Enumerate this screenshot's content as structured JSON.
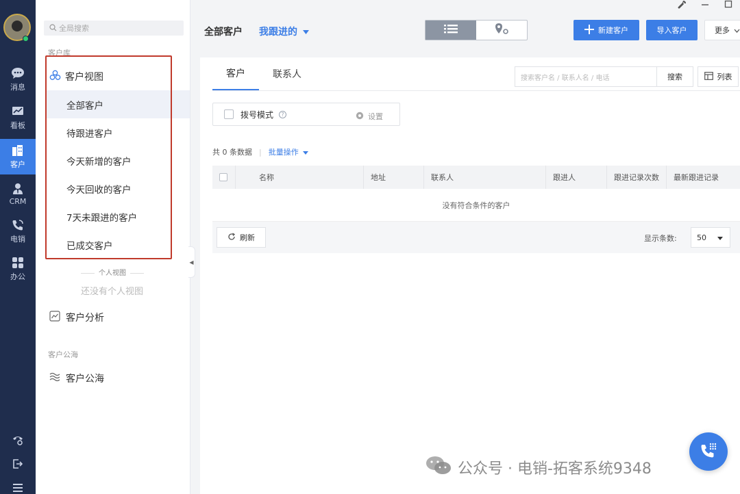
{
  "rail": {
    "items": [
      {
        "label": "消息",
        "icon": "chat-bubble-icon"
      },
      {
        "label": "看板",
        "icon": "dashboard-chart-icon"
      },
      {
        "label": "客户",
        "icon": "building-icon"
      },
      {
        "label": "CRM",
        "icon": "person-tie-icon"
      },
      {
        "label": "电销",
        "icon": "phone-icon"
      },
      {
        "label": "办公",
        "icon": "grid-apps-icon"
      }
    ],
    "bottom_icons": [
      "call-settings-icon",
      "logout-icon",
      "menu-icon"
    ]
  },
  "sidebar": {
    "search_placeholder": "全局搜索",
    "section_customer_library": "客户库",
    "view_header": "客户视图",
    "views": [
      {
        "label": "全部客户",
        "selected": true
      },
      {
        "label": "待跟进客户",
        "selected": false
      },
      {
        "label": "今天新增的客户",
        "selected": false
      },
      {
        "label": "今天回收的客户",
        "selected": false
      },
      {
        "label": "7天未跟进的客户",
        "selected": false
      },
      {
        "label": "已成交客户",
        "selected": false
      }
    ],
    "personal_view_label": "个人视图",
    "personal_view_empty": "还没有个人视图",
    "customer_analysis": "客户分析",
    "section_public_pool": "客户公海",
    "public_pool": "客户公海"
  },
  "header": {
    "crumb": "全部客户",
    "filter_selected": "我跟进的",
    "new_customer": "新建客户",
    "import_customer": "导入客户",
    "more": "更多"
  },
  "main": {
    "tabs": [
      {
        "label": "客户",
        "active": true
      },
      {
        "label": "联系人",
        "active": false
      }
    ],
    "search_placeholder": "搜索客户名 / 联系人名 / 电话",
    "search_button": "搜索",
    "list_button": "列表",
    "dial_mode": "拨号模式",
    "settings": "设置",
    "count_text": "共 0 条数据",
    "bulk_actions": "批量操作",
    "columns": [
      "名称",
      "地址",
      "联系人",
      "跟进人",
      "跟进记录次数",
      "最新跟进记录"
    ],
    "empty_text": "没有符合条件的客户",
    "refresh": "刷新",
    "page_size_label": "显示条数:",
    "page_size_value": "50"
  },
  "watermark": "公众号 · 电销-拓客系统9348",
  "colors": {
    "accent": "#3c7ee6",
    "rail_bg": "#1f2d4d",
    "highlight_border": "#c0392b"
  }
}
